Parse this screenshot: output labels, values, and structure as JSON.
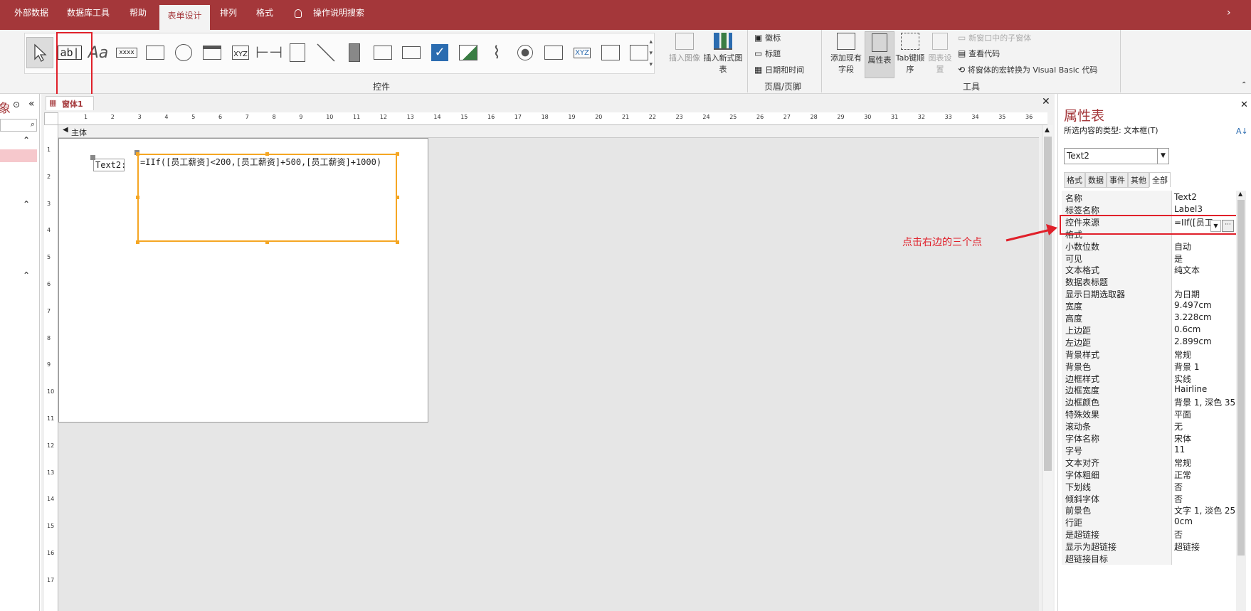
{
  "menu": {
    "tabs": [
      "外部数据",
      "数据库工具",
      "帮助",
      "表单设计",
      "排列",
      "格式"
    ],
    "active": "表单设计",
    "tell_me": "操作说明搜索"
  },
  "ribbon": {
    "controls_group": "控件",
    "insert_image": "插入图像",
    "insert_chart": "插入新式图表",
    "header_items": [
      "徽标",
      "标题",
      "日期和时间"
    ],
    "header_group": "页眉/页脚",
    "add_fields": "添加现有字段",
    "property_sheet": "属性表",
    "tab_order": "Tab键顺序",
    "chart_settings": "图表设置",
    "subform": "新窗口中的子窗体",
    "view_code": "查看代码",
    "convert_macro": "将窗体的宏转换为 Visual Basic 代码",
    "tools_group": "工具"
  },
  "nav": {
    "title": "象"
  },
  "document": {
    "tab": "窗体1",
    "section": "主体",
    "label": "Text2:",
    "textbox": "=IIf([员工薪资]<200,[员工薪资]+500,[员工薪资]+1000)",
    "ruler_h": [
      "1",
      "2",
      "3",
      "4",
      "5",
      "6",
      "7",
      "8",
      "9",
      "10",
      "11",
      "12",
      "13",
      "14",
      "15",
      "16",
      "17",
      "18",
      "19",
      "20",
      "21",
      "22",
      "23",
      "24",
      "25",
      "26",
      "27",
      "28",
      "29",
      "30",
      "31",
      "32",
      "33",
      "34",
      "35",
      "36"
    ],
    "ruler_v": [
      "1",
      "2",
      "3",
      "4",
      "5",
      "6",
      "7",
      "8",
      "9",
      "10",
      "11",
      "12",
      "13",
      "14",
      "15",
      "16",
      "17"
    ]
  },
  "annotation": "点击右边的三个点",
  "props": {
    "title": "属性表",
    "sel_type": "所选内容的类型: 文本框(T)",
    "selected": "Text2",
    "tabs": [
      "格式",
      "数据",
      "事件",
      "其他",
      "全部"
    ],
    "rows": [
      [
        "名称",
        "Text2"
      ],
      [
        "标签名称",
        "Label3"
      ],
      [
        "控件来源",
        "=IIf([员工"
      ],
      [
        "格式",
        ""
      ],
      [
        "小数位数",
        "自动"
      ],
      [
        "可见",
        "是"
      ],
      [
        "文本格式",
        "纯文本"
      ],
      [
        "数据表标题",
        ""
      ],
      [
        "显示日期选取器",
        "为日期"
      ],
      [
        "宽度",
        "9.497cm"
      ],
      [
        "高度",
        "3.228cm"
      ],
      [
        "上边距",
        "0.6cm"
      ],
      [
        "左边距",
        "2.899cm"
      ],
      [
        "背景样式",
        "常规"
      ],
      [
        "背景色",
        "背景 1"
      ],
      [
        "边框样式",
        "实线"
      ],
      [
        "边框宽度",
        "Hairline"
      ],
      [
        "边框颜色",
        "背景 1, 深色 35"
      ],
      [
        "特殊效果",
        "平面"
      ],
      [
        "滚动条",
        "无"
      ],
      [
        "字体名称",
        "宋体"
      ],
      [
        "字号",
        "11"
      ],
      [
        "文本对齐",
        "常规"
      ],
      [
        "字体粗细",
        "正常"
      ],
      [
        "下划线",
        "否"
      ],
      [
        "倾斜字体",
        "否"
      ],
      [
        "前景色",
        "文字 1, 淡色 25"
      ],
      [
        "行距",
        "0cm"
      ],
      [
        "是超链接",
        "否"
      ],
      [
        "显示为超链接",
        "超链接"
      ],
      [
        "超链接目标",
        ""
      ]
    ]
  },
  "colors": {
    "accent": "#a4373a",
    "select": "#f5a623",
    "annot": "#e0202a"
  }
}
